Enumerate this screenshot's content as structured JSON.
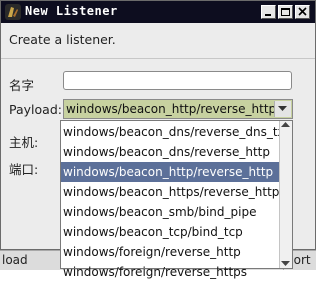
{
  "window": {
    "title": "New Listener",
    "controls": [
      "minimize",
      "maximize",
      "close"
    ]
  },
  "form": {
    "subtitle": "Create a listener.",
    "name_label": "名字",
    "name_value": "",
    "payload_label": "Payload:",
    "payload_value": "windows/beacon_http/reverse_http",
    "host_label": "主机:",
    "port_label": "端口:"
  },
  "dropdown": {
    "options": [
      "windows/beacon_dns/reverse_dns_txt",
      "windows/beacon_dns/reverse_http",
      "windows/beacon_http/reverse_http",
      "windows/beacon_https/reverse_https",
      "windows/beacon_smb/bind_pipe",
      "windows/beacon_tcp/bind_tcp",
      "windows/foreign/reverse_http",
      "windows/foreign/reverse_https"
    ],
    "selected_index": 2
  },
  "bottom_bar": {
    "left_text": "load",
    "right_text": "port"
  },
  "colors": {
    "titlebar": "#0d0d1f",
    "selected_option": "#5c7099",
    "select_background": "#c7d1a0"
  }
}
